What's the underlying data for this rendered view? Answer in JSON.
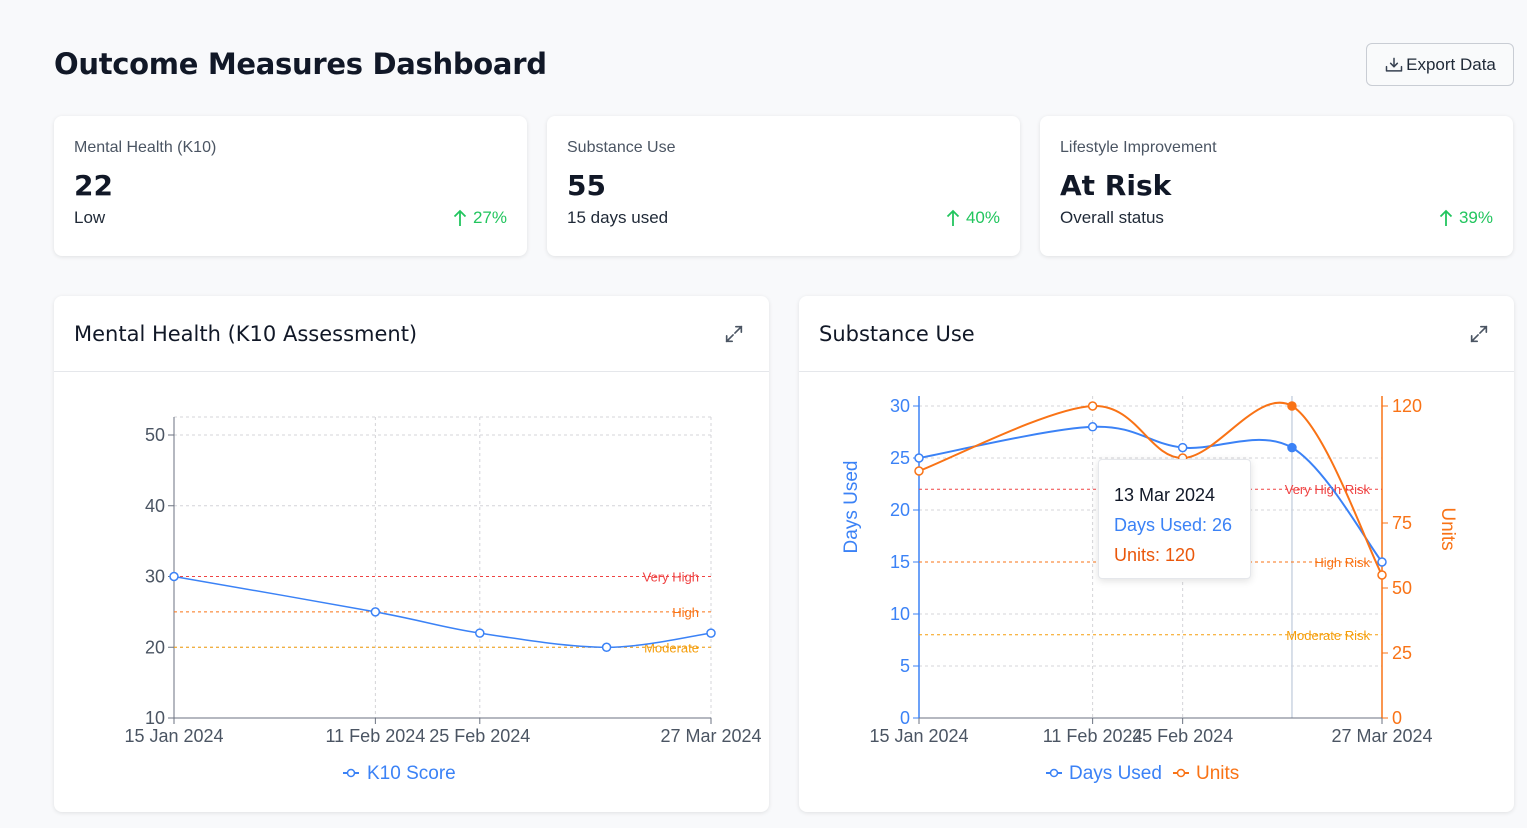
{
  "header": {
    "title": "Outcome Measures Dashboard",
    "export_label": "Export Data"
  },
  "kpis": [
    {
      "label": "Mental Health (K10)",
      "value": "22",
      "sub": "Low",
      "trend": "27%"
    },
    {
      "label": "Substance Use",
      "value": "55",
      "sub": "15 days used",
      "trend": "40%"
    },
    {
      "label": "Lifestyle Improvement",
      "value": "At Risk",
      "sub": "Overall status",
      "trend": "39%"
    }
  ],
  "colors": {
    "blue": "#3b82f6",
    "orange": "#f97316",
    "red": "#ef4444",
    "amber": "#f59e0b",
    "green": "#22c55e"
  },
  "charts": {
    "mental": {
      "title": "Mental Health (K10 Assessment)"
    },
    "substance": {
      "title": "Substance Use"
    }
  },
  "tooltip": {
    "date": "13 Mar 2024",
    "days": "Days Used: 26",
    "units": "Units: 120"
  },
  "chart_data": [
    {
      "type": "line",
      "x_tick_labels": [
        "15 Jan 2024",
        "11 Feb 2024",
        "25 Feb 2024",
        "27 Mar 2024"
      ],
      "x": [
        "2024-01-15",
        "2024-02-11",
        "2024-02-25",
        "2024-03-13",
        "2024-03-27"
      ],
      "series": [
        {
          "name": "K10 Score",
          "values": [
            30,
            25,
            22,
            20,
            22
          ]
        }
      ],
      "ylim": [
        10,
        50
      ],
      "yticks": [
        10,
        20,
        30,
        40,
        50
      ],
      "thresholds": [
        {
          "label": "Very High",
          "value": 30,
          "color": "#ef4444"
        },
        {
          "label": "High",
          "value": 25,
          "color": "#f97316"
        },
        {
          "label": "Moderate",
          "value": 20,
          "color": "#f59e0b"
        }
      ],
      "legend": "bottom",
      "grid": true
    },
    {
      "type": "line",
      "x_tick_labels": [
        "15 Jan 2024",
        "11 Feb 2024",
        "25 Feb 2024",
        "27 Mar 2024"
      ],
      "x": [
        "2024-01-15",
        "2024-02-11",
        "2024-02-25",
        "2024-03-13",
        "2024-03-27"
      ],
      "series": [
        {
          "name": "Days Used",
          "axis": "left",
          "values": [
            25,
            28,
            26,
            26,
            15
          ]
        },
        {
          "name": "Units",
          "axis": "right",
          "values": [
            95,
            120,
            100,
            120,
            55
          ]
        }
      ],
      "ylabel": "Days Used",
      "y2label": "Units",
      "ylim": [
        0,
        30
      ],
      "yticks": [
        0,
        5,
        10,
        15,
        20,
        25,
        30
      ],
      "y2lim": [
        0,
        120
      ],
      "y2ticks": [
        0,
        25,
        50,
        75,
        120
      ],
      "thresholds": [
        {
          "label": "Very High Risk",
          "value": 22,
          "color": "#ef4444"
        },
        {
          "label": "High Risk",
          "value": 15,
          "color": "#f97316"
        },
        {
          "label": "Moderate Risk",
          "value": 8,
          "color": "#f59e0b"
        }
      ],
      "highlight_x": "2024-03-13",
      "legend": "bottom",
      "grid": true
    }
  ]
}
